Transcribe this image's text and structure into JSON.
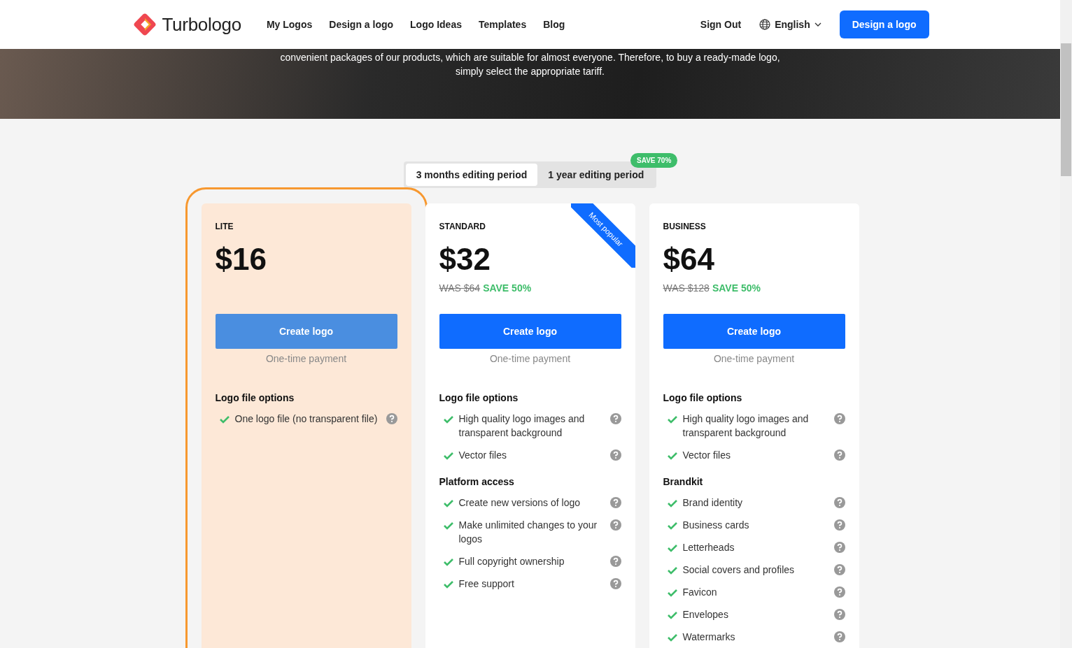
{
  "header": {
    "logo": "Turbologo",
    "nav": [
      "My Logos",
      "Design a logo",
      "Logo Ideas",
      "Templates",
      "Blog"
    ],
    "sign_out": "Sign Out",
    "language": "English",
    "cta": "Design a logo"
  },
  "hero": {
    "text_lines": [
      "convenient packages of our products, which are suitable for almost everyone. Therefore, to buy a ready-made logo,",
      "simply select the appropriate tariff."
    ]
  },
  "period_tabs": [
    {
      "label": "3 months editing period",
      "selected": true
    },
    {
      "label": "1 year editing period",
      "selected": false,
      "badge": "SAVE 70%"
    }
  ],
  "plans": [
    {
      "name": "LITE",
      "price": "$16",
      "selected": true,
      "button": "Create logo",
      "payment": "One-time payment",
      "sections": [
        {
          "title": "Logo file options",
          "items": [
            "One logo file (no transparent file)"
          ]
        }
      ]
    },
    {
      "name": "STANDARD",
      "price": "$32",
      "was": "WAS $64",
      "save": "SAVE 50%",
      "ribbon": "Most popular",
      "selected": false,
      "button": "Create logo",
      "payment": "One-time payment",
      "sections": [
        {
          "title": "Logo file options",
          "items": [
            "High quality logo images and transparent background",
            "Vector files"
          ]
        },
        {
          "title": "Platform access",
          "items": [
            "Create new versions of logo",
            "Make unlimited changes to your logos",
            "Full copyright ownership",
            "Free support"
          ]
        }
      ]
    },
    {
      "name": "BUSINESS",
      "price": "$64",
      "was": "WAS $128",
      "save": "SAVE 50%",
      "selected": false,
      "button": "Create logo",
      "payment": "One-time payment",
      "sections": [
        {
          "title": "Logo file options",
          "items": [
            "High quality logo images and transparent background",
            "Vector files"
          ]
        },
        {
          "title": "Brandkit",
          "items": [
            "Brand identity",
            "Business cards",
            "Letterheads",
            "Social covers and profiles",
            "Favicon",
            "Envelopes",
            "Watermarks"
          ]
        }
      ]
    }
  ]
}
